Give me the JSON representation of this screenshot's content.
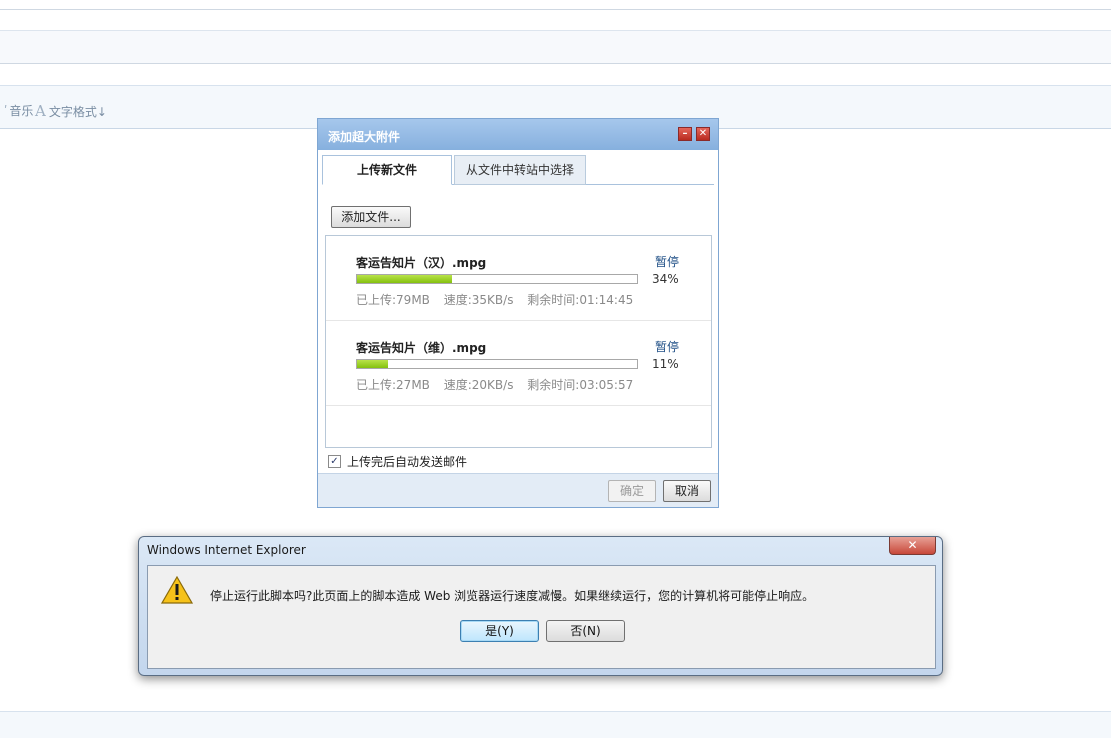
{
  "toolbar": {
    "music_label": "音乐",
    "text_format_label": "文字格式↓"
  },
  "upload_dialog": {
    "title": "添加超大附件",
    "tabs": [
      {
        "label": "上传新文件",
        "active": true
      },
      {
        "label": "从文件中转站中选择",
        "active": false
      }
    ],
    "add_file_label": "添加文件...",
    "files": [
      {
        "name": "客运告知片（汉）.mpg",
        "action": "暂停",
        "percent_label": "34%",
        "progress": 34,
        "uploaded": "已上传:79MB",
        "speed": "速度:35KB/s",
        "remaining": "剩余时间:01:14:45"
      },
      {
        "name": "客运告知片（维）.mpg",
        "action": "暂停",
        "percent_label": "11%",
        "progress": 11,
        "uploaded": "已上传:27MB",
        "speed": "速度:20KB/s",
        "remaining": "剩余时间:03:05:57"
      }
    ],
    "auto_send_label": "上传完后自动发送邮件",
    "auto_send_checked": true,
    "ok_label": "确定",
    "cancel_label": "取消"
  },
  "ie_dialog": {
    "title": "Windows Internet Explorer",
    "message": "停止运行此脚本吗?此页面上的脚本造成 Web 浏览器运行速度减慢。如果继续运行，您的计算机将可能停止响应。",
    "yes_label": "是(Y)",
    "no_label": "否(N)"
  },
  "colors": {
    "progress_fill": "#9fd22d",
    "dialog_title_bar": "#8fb6e2",
    "link": "#1f4f86"
  }
}
